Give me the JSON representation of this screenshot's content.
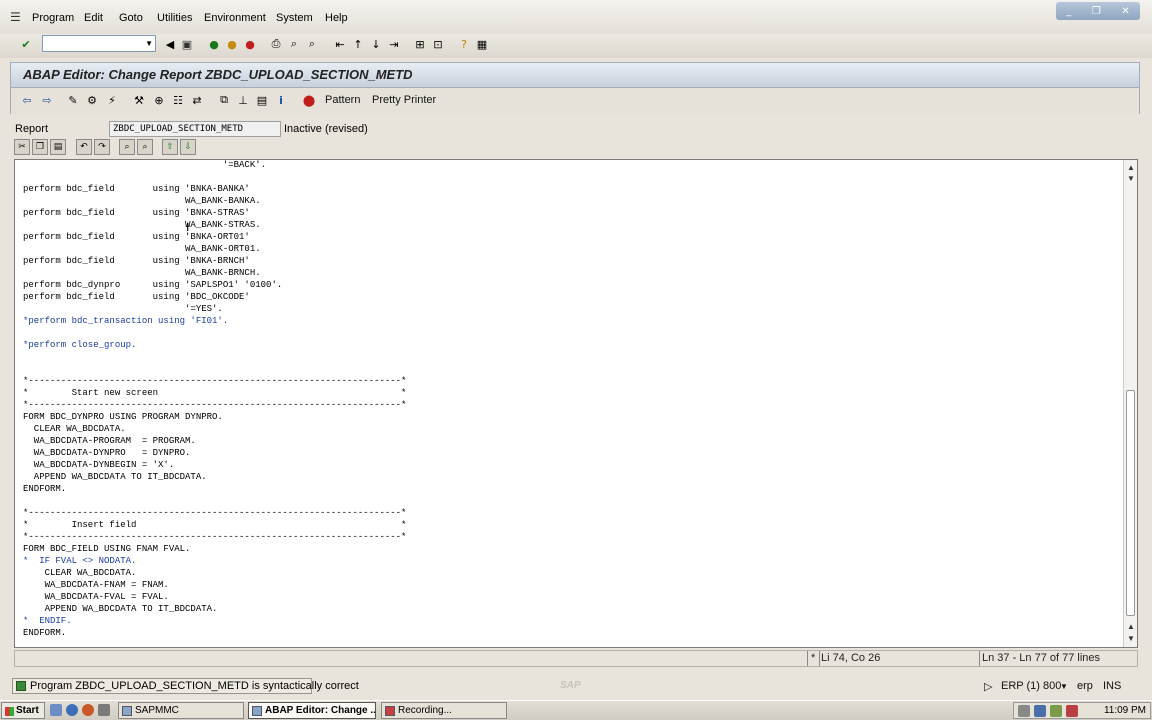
{
  "menubar": {
    "items": [
      "Program",
      "Edit",
      "Goto",
      "Utilities",
      "Environment",
      "System",
      "Help"
    ]
  },
  "window_controls": {
    "minimize": "_",
    "restore": "❐",
    "close": "✕"
  },
  "command_field": {
    "value": ""
  },
  "title": "ABAP Editor: Change Report ZBDC_UPLOAD_SECTION_METD",
  "app_toolbar": {
    "pattern_label": "Pattern",
    "pretty_printer_label": "Pretty Printer"
  },
  "report": {
    "label": "Report",
    "name": "ZBDC_UPLOAD_SECTION_METD",
    "status": "Inactive (revised)"
  },
  "code_lines": [
    {
      "text": "                                     '=BACK'.",
      "comment": false
    },
    {
      "text": "",
      "comment": false
    },
    {
      "text": "perform bdc_field       using 'BNKA-BANKA'",
      "comment": false
    },
    {
      "text": "                              WA_BANK-BANKA.",
      "comment": false
    },
    {
      "text": "perform bdc_field       using 'BNKA-STRAS'",
      "comment": false
    },
    {
      "text": "                              WA_BANK-STRAS.",
      "comment": false
    },
    {
      "text": "perform bdc_field       using 'BNKA-ORT01'",
      "comment": false
    },
    {
      "text": "                              WA_BANK-ORT01.",
      "comment": false
    },
    {
      "text": "perform bdc_field       using 'BNKA-BRNCH'",
      "comment": false
    },
    {
      "text": "                              WA_BANK-BRNCH.",
      "comment": false
    },
    {
      "text": "perform bdc_dynpro      using 'SAPLSPO1' '0100'.",
      "comment": false
    },
    {
      "text": "perform bdc_field       using 'BDC_OKCODE'",
      "comment": false
    },
    {
      "text": "                              '=YES'.",
      "comment": false
    },
    {
      "text": "*perform bdc_transaction using 'FI01'.",
      "comment": true
    },
    {
      "text": "",
      "comment": false
    },
    {
      "text": "*perform close_group.",
      "comment": true
    },
    {
      "text": "",
      "comment": false
    },
    {
      "text": "",
      "comment": false
    },
    {
      "text": "*---------------------------------------------------------------------*",
      "comment": false
    },
    {
      "text": "*        Start new screen                                             *",
      "comment": false
    },
    {
      "text": "*---------------------------------------------------------------------*",
      "comment": false
    },
    {
      "text": "FORM BDC_DYNPRO USING PROGRAM DYNPRO.",
      "comment": false
    },
    {
      "text": "  CLEAR WA_BDCDATA.",
      "comment": false
    },
    {
      "text": "  WA_BDCDATA-PROGRAM  = PROGRAM.",
      "comment": false
    },
    {
      "text": "  WA_BDCDATA-DYNPRO   = DYNPRO.",
      "comment": false
    },
    {
      "text": "  WA_BDCDATA-DYNBEGIN = 'X'.",
      "comment": false
    },
    {
      "text": "  APPEND WA_BDCDATA TO IT_BDCDATA.",
      "comment": false
    },
    {
      "text": "ENDFORM.",
      "comment": false
    },
    {
      "text": "",
      "comment": false
    },
    {
      "text": "*---------------------------------------------------------------------*",
      "comment": false
    },
    {
      "text": "*        Insert field                                                 *",
      "comment": false
    },
    {
      "text": "*---------------------------------------------------------------------*",
      "comment": false
    },
    {
      "text": "FORM BDC_FIELD USING FNAM FVAL.",
      "comment": false
    },
    {
      "text": "*  IF FVAL <> NODATA.",
      "comment": true
    },
    {
      "text": "    CLEAR WA_BDCDATA.",
      "comment": false
    },
    {
      "text": "    WA_BDCDATA-FNAM = FNAM.",
      "comment": false
    },
    {
      "text": "    WA_BDCDATA-FVAL = FVAL.",
      "comment": false
    },
    {
      "text": "    APPEND WA_BDCDATA TO IT_BDCDATA.",
      "comment": false
    },
    {
      "text": "*  ENDIF.",
      "comment": true
    },
    {
      "text": "ENDFORM.",
      "comment": false
    }
  ],
  "editor_status": {
    "marker": "*",
    "position": "Li 74, Co 26",
    "lines": "Ln 37 - Ln 77 of 77 lines"
  },
  "status_message": "Program ZBDC_UPLOAD_SECTION_METD is syntactically correct",
  "system_info": {
    "system": "ERP (1) 800",
    "server": "erp",
    "mode": "INS"
  },
  "taskbar": {
    "start_label": "Start",
    "tasks": [
      {
        "label": "SAPMMC",
        "active": false
      },
      {
        "label": "ABAP Editor: Change ...",
        "active": true
      },
      {
        "label": "Recording...",
        "active": false
      }
    ],
    "clock": "11:09 PM"
  }
}
